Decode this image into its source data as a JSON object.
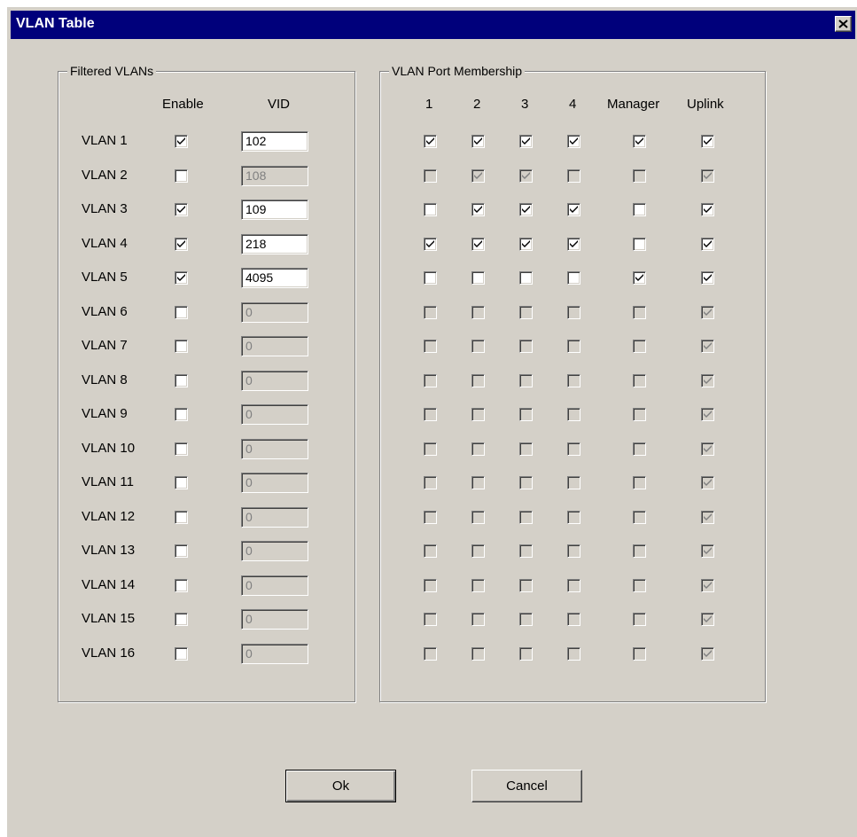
{
  "window": {
    "title": "VLAN Table"
  },
  "filtered": {
    "group_label": "Filtered VLANs",
    "enable_header": "Enable",
    "vid_header": "VID"
  },
  "membership": {
    "group_label": "VLAN Port Membership",
    "column_headers": [
      "1",
      "2",
      "3",
      "4",
      "Manager",
      "Uplink"
    ]
  },
  "vlans": [
    {
      "label": "VLAN 1",
      "enabled": true,
      "vid": "102",
      "ports": [
        true,
        true,
        true,
        true,
        true,
        true
      ]
    },
    {
      "label": "VLAN 2",
      "enabled": false,
      "vid": "108",
      "ports": [
        false,
        true,
        true,
        false,
        false,
        true
      ]
    },
    {
      "label": "VLAN 3",
      "enabled": true,
      "vid": "109",
      "ports": [
        false,
        true,
        true,
        true,
        false,
        true
      ]
    },
    {
      "label": "VLAN 4",
      "enabled": true,
      "vid": "218",
      "ports": [
        true,
        true,
        true,
        true,
        false,
        true
      ]
    },
    {
      "label": "VLAN 5",
      "enabled": true,
      "vid": "4095",
      "ports": [
        false,
        false,
        false,
        false,
        true,
        true
      ]
    },
    {
      "label": "VLAN 6",
      "enabled": false,
      "vid": "0",
      "ports": [
        false,
        false,
        false,
        false,
        false,
        true
      ]
    },
    {
      "label": "VLAN 7",
      "enabled": false,
      "vid": "0",
      "ports": [
        false,
        false,
        false,
        false,
        false,
        true
      ]
    },
    {
      "label": "VLAN 8",
      "enabled": false,
      "vid": "0",
      "ports": [
        false,
        false,
        false,
        false,
        false,
        true
      ]
    },
    {
      "label": "VLAN 9",
      "enabled": false,
      "vid": "0",
      "ports": [
        false,
        false,
        false,
        false,
        false,
        true
      ]
    },
    {
      "label": "VLAN 10",
      "enabled": false,
      "vid": "0",
      "ports": [
        false,
        false,
        false,
        false,
        false,
        true
      ]
    },
    {
      "label": "VLAN 11",
      "enabled": false,
      "vid": "0",
      "ports": [
        false,
        false,
        false,
        false,
        false,
        true
      ]
    },
    {
      "label": "VLAN 12",
      "enabled": false,
      "vid": "0",
      "ports": [
        false,
        false,
        false,
        false,
        false,
        true
      ]
    },
    {
      "label": "VLAN 13",
      "enabled": false,
      "vid": "0",
      "ports": [
        false,
        false,
        false,
        false,
        false,
        true
      ]
    },
    {
      "label": "VLAN 14",
      "enabled": false,
      "vid": "0",
      "ports": [
        false,
        false,
        false,
        false,
        false,
        true
      ]
    },
    {
      "label": "VLAN 15",
      "enabled": false,
      "vid": "0",
      "ports": [
        false,
        false,
        false,
        false,
        false,
        true
      ]
    },
    {
      "label": "VLAN 16",
      "enabled": false,
      "vid": "0",
      "ports": [
        false,
        false,
        false,
        false,
        false,
        true
      ]
    }
  ],
  "buttons": {
    "ok": "Ok",
    "cancel": "Cancel"
  },
  "colors": {
    "title_bar": "#00007b",
    "dialog_face": "#d4d0c8"
  }
}
